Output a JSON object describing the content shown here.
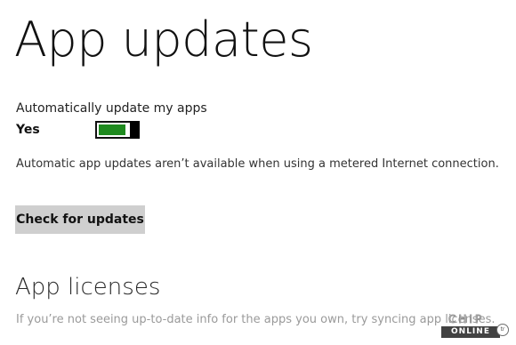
{
  "page": {
    "title": "App updates"
  },
  "auto_update": {
    "label": "Automatically update my apps",
    "state": "Yes",
    "enabled": true,
    "toggle_on_color": "#1f8a1f"
  },
  "info": {
    "metered_note": "Automatic app updates aren’t available when using a metered Internet connection."
  },
  "actions": {
    "check_button_label": "Check for updates"
  },
  "licenses": {
    "title": "App licenses",
    "description": "If you’re not seeing up-to-date info for the apps you own, try syncing app licenses."
  },
  "watermark": {
    "upper": "CHIP",
    "lower": "ONLINE",
    "badge": "tr"
  }
}
